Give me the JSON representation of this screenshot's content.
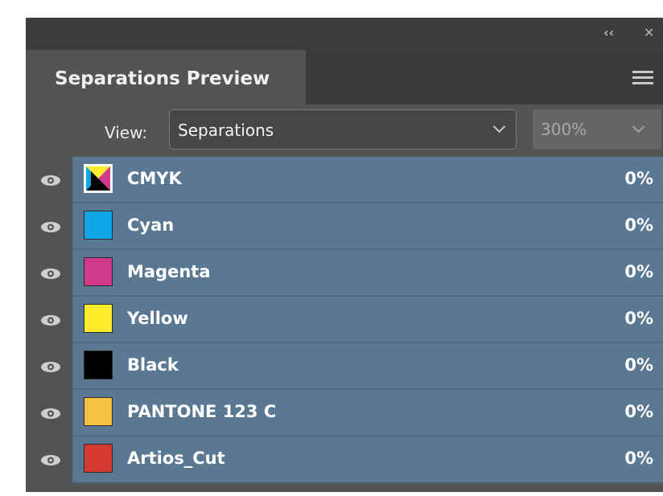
{
  "panel": {
    "collapse_icon": "double-chevron-left-icon",
    "close_icon": "close-icon",
    "tab_label": "Separations Preview",
    "menu_icon": "hamburger-menu-icon"
  },
  "view": {
    "label": "View:",
    "selected": "Separations",
    "zoom": "300%"
  },
  "separations": [
    {
      "name": "CMYK",
      "percent": "0%",
      "swatch": "cmyk",
      "color": "#000000",
      "visible": true
    },
    {
      "name": "Cyan",
      "percent": "0%",
      "swatch": "solid",
      "color": "#0fa7e8",
      "visible": true
    },
    {
      "name": "Magenta",
      "percent": "0%",
      "swatch": "solid",
      "color": "#d13a8c",
      "visible": true
    },
    {
      "name": "Yellow",
      "percent": "0%",
      "swatch": "solid",
      "color": "#ffec2c",
      "visible": true
    },
    {
      "name": "Black",
      "percent": "0%",
      "swatch": "solid",
      "color": "#000000",
      "visible": true
    },
    {
      "name": "PANTONE 123 C",
      "percent": "0%",
      "swatch": "solid",
      "color": "#f5c242",
      "visible": true
    },
    {
      "name": "Artios_Cut",
      "percent": "0%",
      "swatch": "solid",
      "color": "#d6392f",
      "visible": true
    }
  ],
  "colors": {
    "row_highlight": "#5a7892",
    "panel_bg": "#535353"
  }
}
